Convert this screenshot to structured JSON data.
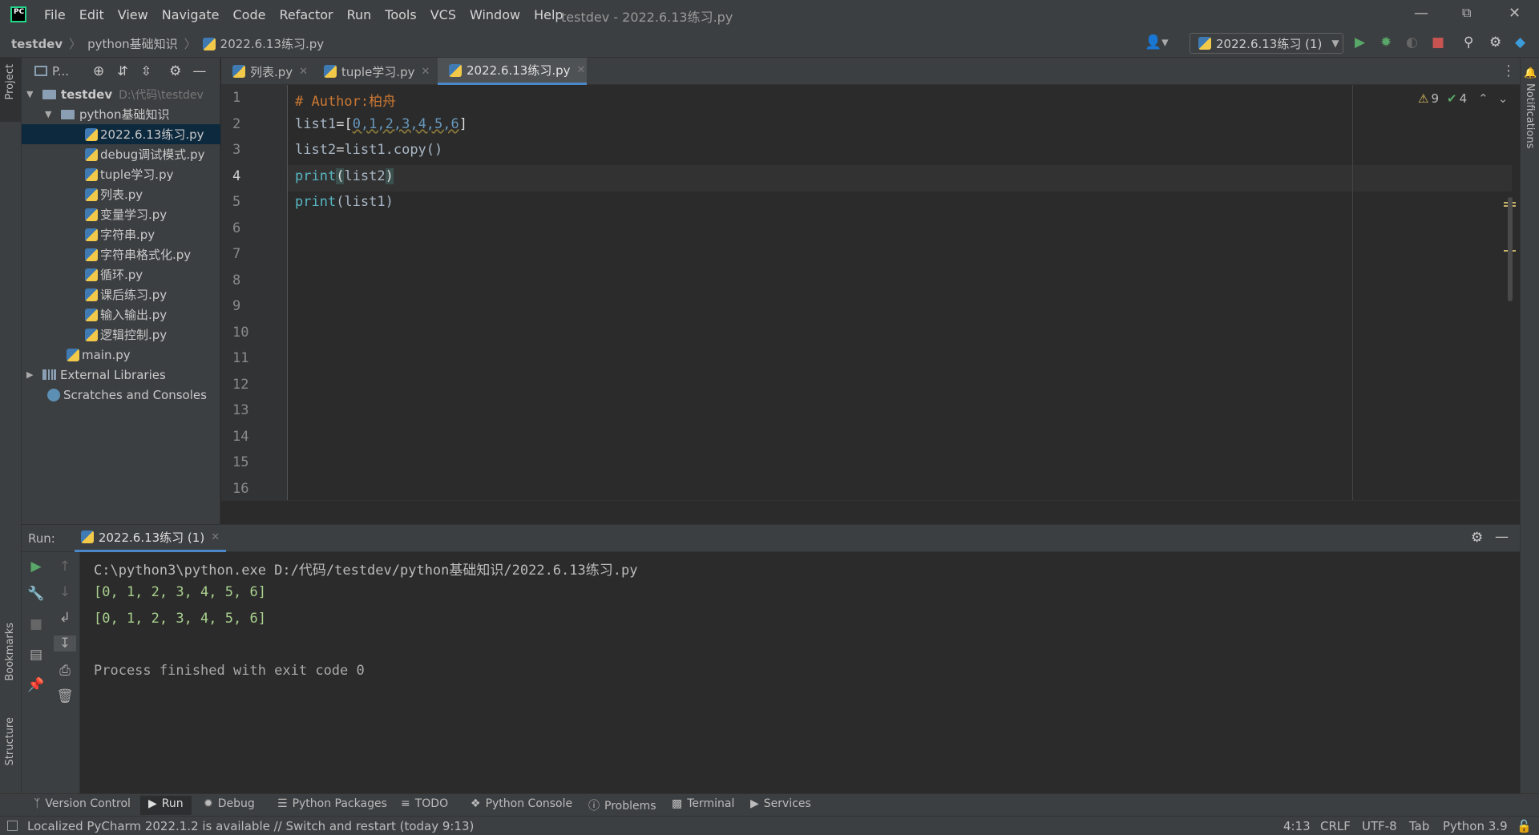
{
  "titlebar": {
    "menu": [
      "File",
      "Edit",
      "View",
      "Navigate",
      "Code",
      "Refactor",
      "Run",
      "Tools",
      "VCS",
      "Window",
      "Help"
    ],
    "window_title": "testdev - 2022.6.13练习.py"
  },
  "navbar": {
    "breadcrumb": [
      "testdev",
      "python基础知识",
      "2022.6.13练习.py"
    ],
    "run_config": "2022.6.13练习 (1)"
  },
  "left_stripe": {
    "project": "Project",
    "bookmarks": "Bookmarks",
    "structure": "Structure"
  },
  "right_stripe": {
    "notifications": "Notifications"
  },
  "project": {
    "header": "P...",
    "root": {
      "name": "testdev",
      "path": "D:\\代码\\testdev"
    },
    "folder": "python基础知识",
    "files": [
      "2022.6.13练习.py",
      "debug调试模式.py",
      "tuple学习.py",
      "列表.py",
      "变量学习.py",
      "字符串.py",
      "字符串格式化.py",
      "循环.py",
      "课后练习.py",
      "输入输出.py",
      "逻辑控制.py"
    ],
    "main": "main.py",
    "external": "External Libraries",
    "scratches": "Scratches and Consoles"
  },
  "tabs": [
    "列表.py",
    "tuple学习.py",
    "2022.6.13练习.py"
  ],
  "editor": {
    "line_numbers": [
      "1",
      "2",
      "3",
      "4",
      "5",
      "6",
      "7",
      "8",
      "9",
      "10",
      "11",
      "12",
      "13",
      "14",
      "15",
      "16"
    ],
    "code": {
      "comment": "# Author:柏舟",
      "l2_name": "list1",
      "l2_eq": "=",
      "l2_open": "[",
      "l2_items": "0,1,2,3,4,5,6",
      "l2_close": "]",
      "l3_name": "list2",
      "l3_eq": "=",
      "l3_rest": "list1.copy()",
      "l4_fn": "print",
      "l4_open": "(",
      "l4_arg": "list2",
      "l4_close": ")",
      "l5_fn": "print",
      "l5_rest": "(list1)"
    },
    "warnings": "9",
    "weak_warnings": "4"
  },
  "run": {
    "label": "Run:",
    "tab": "2022.6.13练习 (1)",
    "output": [
      "C:\\python3\\python.exe D:/代码/testdev/python基础知识/2022.6.13练习.py",
      "[0, 1, 2, 3, 4, 5, 6]",
      "[0, 1, 2, 3, 4, 5, 6]",
      "",
      "Process finished with exit code 0"
    ]
  },
  "toolwindows": [
    "Version Control",
    "Run",
    "Debug",
    "Python Packages",
    "TODO",
    "Python Console",
    "Problems",
    "Terminal",
    "Services"
  ],
  "status": {
    "message": "Localized PyCharm 2022.1.2 is available // Switch and restart (today 9:13)",
    "position": "4:13",
    "line_sep": "CRLF",
    "encoding": "UTF-8",
    "indent": "Tab",
    "interpreter": "Python 3.9"
  },
  "colors": {
    "accent": "#4a88c7",
    "keyword_fn": "#56b6c2",
    "comment": "#cc7832",
    "number": "#6897bb",
    "run_green": "#59a869",
    "stop_red": "#c75450"
  }
}
